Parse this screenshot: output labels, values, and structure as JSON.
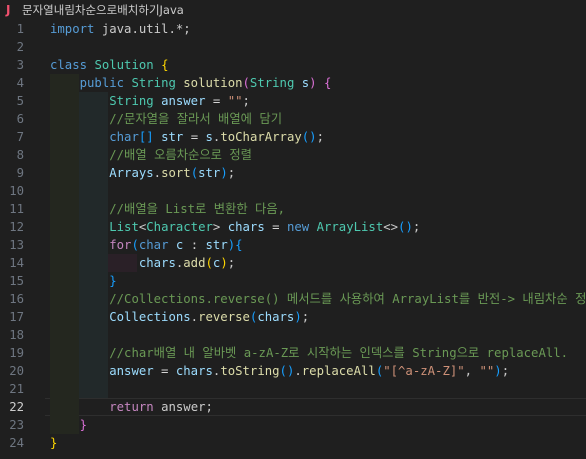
{
  "tab": {
    "icon": "J",
    "title": "문자열내림차순으로배치하기Java"
  },
  "active_line": 22,
  "lines": [
    {
      "n": "1",
      "tokens": [
        {
          "t": "import",
          "c": "kw"
        },
        {
          "t": " java.util.*;",
          "c": ""
        }
      ]
    },
    {
      "n": "2",
      "tokens": []
    },
    {
      "n": "3",
      "tokens": [
        {
          "t": "class",
          "c": "kw"
        },
        {
          "t": " ",
          "c": ""
        },
        {
          "t": "Solution",
          "c": "ty"
        },
        {
          "t": " ",
          "c": ""
        },
        {
          "t": "{",
          "c": "pn"
        }
      ]
    },
    {
      "n": "4",
      "tokens": [
        {
          "t": "    ",
          "c": ""
        },
        {
          "t": "public",
          "c": "kw"
        },
        {
          "t": " ",
          "c": ""
        },
        {
          "t": "String",
          "c": "ty"
        },
        {
          "t": " ",
          "c": ""
        },
        {
          "t": "solution",
          "c": "fn"
        },
        {
          "t": "(",
          "c": "pp"
        },
        {
          "t": "String",
          "c": "ty"
        },
        {
          "t": " ",
          "c": ""
        },
        {
          "t": "s",
          "c": "var"
        },
        {
          "t": ")",
          "c": "pp"
        },
        {
          "t": " ",
          "c": ""
        },
        {
          "t": "{",
          "c": "pp"
        }
      ]
    },
    {
      "n": "5",
      "tokens": [
        {
          "t": "        ",
          "c": ""
        },
        {
          "t": "String",
          "c": "ty"
        },
        {
          "t": " ",
          "c": ""
        },
        {
          "t": "answer",
          "c": "var"
        },
        {
          "t": " = ",
          "c": "op"
        },
        {
          "t": "\"\"",
          "c": "str"
        },
        {
          "t": ";",
          "c": ""
        }
      ]
    },
    {
      "n": "6",
      "tokens": [
        {
          "t": "        ",
          "c": ""
        },
        {
          "t": "//문자열을 잘라서 배열에 담기",
          "c": "cm"
        }
      ]
    },
    {
      "n": "7",
      "tokens": [
        {
          "t": "        ",
          "c": ""
        },
        {
          "t": "char",
          "c": "kw"
        },
        {
          "t": "[]",
          "c": "pb"
        },
        {
          "t": " ",
          "c": ""
        },
        {
          "t": "str",
          "c": "var"
        },
        {
          "t": " = ",
          "c": "op"
        },
        {
          "t": "s",
          "c": "var"
        },
        {
          "t": ".",
          "c": ""
        },
        {
          "t": "toCharArray",
          "c": "fn"
        },
        {
          "t": "()",
          "c": "pb"
        },
        {
          "t": ";",
          "c": ""
        }
      ]
    },
    {
      "n": "8",
      "tokens": [
        {
          "t": "        ",
          "c": ""
        },
        {
          "t": "//배열 오름차순으로 정렬",
          "c": "cm"
        }
      ]
    },
    {
      "n": "9",
      "tokens": [
        {
          "t": "        ",
          "c": ""
        },
        {
          "t": "Arrays",
          "c": "var"
        },
        {
          "t": ".",
          "c": ""
        },
        {
          "t": "sort",
          "c": "fn"
        },
        {
          "t": "(",
          "c": "pb"
        },
        {
          "t": "str",
          "c": "var"
        },
        {
          "t": ")",
          "c": "pb"
        },
        {
          "t": ";",
          "c": ""
        }
      ]
    },
    {
      "n": "10",
      "tokens": []
    },
    {
      "n": "11",
      "tokens": [
        {
          "t": "        ",
          "c": ""
        },
        {
          "t": "//배열을 List로 변환한 다음,",
          "c": "cm"
        }
      ]
    },
    {
      "n": "12",
      "tokens": [
        {
          "t": "        ",
          "c": ""
        },
        {
          "t": "List",
          "c": "ty"
        },
        {
          "t": "<",
          "c": ""
        },
        {
          "t": "Character",
          "c": "ty"
        },
        {
          "t": ">",
          "c": ""
        },
        {
          "t": " ",
          "c": ""
        },
        {
          "t": "chars",
          "c": "var"
        },
        {
          "t": " = ",
          "c": "op"
        },
        {
          "t": "new",
          "c": "kw"
        },
        {
          "t": " ",
          "c": ""
        },
        {
          "t": "ArrayList",
          "c": "ty"
        },
        {
          "t": "<>",
          "c": ""
        },
        {
          "t": "()",
          "c": "pb"
        },
        {
          "t": ";",
          "c": ""
        }
      ]
    },
    {
      "n": "13",
      "tokens": [
        {
          "t": "        ",
          "c": ""
        },
        {
          "t": "for",
          "c": "ctl"
        },
        {
          "t": "(",
          "c": "pb"
        },
        {
          "t": "char",
          "c": "kw"
        },
        {
          "t": " ",
          "c": ""
        },
        {
          "t": "c",
          "c": "var"
        },
        {
          "t": " : ",
          "c": ""
        },
        {
          "t": "str",
          "c": "var"
        },
        {
          "t": ")",
          "c": "pb"
        },
        {
          "t": "{",
          "c": "pb"
        }
      ]
    },
    {
      "n": "14",
      "tokens": [
        {
          "t": "            ",
          "c": ""
        },
        {
          "t": "chars",
          "c": "var"
        },
        {
          "t": ".",
          "c": ""
        },
        {
          "t": "add",
          "c": "fn"
        },
        {
          "t": "(",
          "c": "pn"
        },
        {
          "t": "c",
          "c": "var"
        },
        {
          "t": ")",
          "c": "pn"
        },
        {
          "t": ";",
          "c": ""
        }
      ]
    },
    {
      "n": "15",
      "tokens": [
        {
          "t": "        ",
          "c": ""
        },
        {
          "t": "}",
          "c": "pb"
        }
      ]
    },
    {
      "n": "16",
      "tokens": [
        {
          "t": "        ",
          "c": ""
        },
        {
          "t": "//Collections.reverse() 메서드를 사용하여 ArrayList를 반전-> 내림차순 정렬",
          "c": "cm"
        }
      ]
    },
    {
      "n": "17",
      "tokens": [
        {
          "t": "        ",
          "c": ""
        },
        {
          "t": "Collections",
          "c": "var"
        },
        {
          "t": ".",
          "c": ""
        },
        {
          "t": "reverse",
          "c": "fn"
        },
        {
          "t": "(",
          "c": "pb"
        },
        {
          "t": "chars",
          "c": "var"
        },
        {
          "t": ")",
          "c": "pb"
        },
        {
          "t": ";",
          "c": ""
        }
      ]
    },
    {
      "n": "18",
      "tokens": []
    },
    {
      "n": "19",
      "tokens": [
        {
          "t": "        ",
          "c": ""
        },
        {
          "t": "//char배열 내 알바벳 a-zA-Z로 시작하는 인덱스를 String으로 replaceAll.",
          "c": "cm"
        }
      ]
    },
    {
      "n": "20",
      "tokens": [
        {
          "t": "        ",
          "c": ""
        },
        {
          "t": "answer",
          "c": "var"
        },
        {
          "t": " = ",
          "c": "op"
        },
        {
          "t": "chars",
          "c": "var"
        },
        {
          "t": ".",
          "c": ""
        },
        {
          "t": "toString",
          "c": "fn"
        },
        {
          "t": "()",
          "c": "pb"
        },
        {
          "t": ".",
          "c": ""
        },
        {
          "t": "replaceAll",
          "c": "fn"
        },
        {
          "t": "(",
          "c": "pb"
        },
        {
          "t": "\"[^a-zA-Z]\"",
          "c": "str"
        },
        {
          "t": ", ",
          "c": ""
        },
        {
          "t": "\"\"",
          "c": "str"
        },
        {
          "t": ")",
          "c": "pb"
        },
        {
          "t": ";",
          "c": ""
        }
      ]
    },
    {
      "n": "21",
      "tokens": []
    },
    {
      "n": "22",
      "tokens": [
        {
          "t": "    ",
          "c": ""
        },
        {
          "t": "    ",
          "c": ""
        },
        {
          "t": "return",
          "c": "ctl"
        },
        {
          "t": " answer;",
          "c": ""
        }
      ]
    },
    {
      "n": "23",
      "tokens": [
        {
          "t": "    ",
          "c": ""
        },
        {
          "t": "}",
          "c": "pp"
        }
      ]
    },
    {
      "n": "24",
      "tokens": [
        {
          "t": "}",
          "c": "pn"
        }
      ]
    }
  ]
}
